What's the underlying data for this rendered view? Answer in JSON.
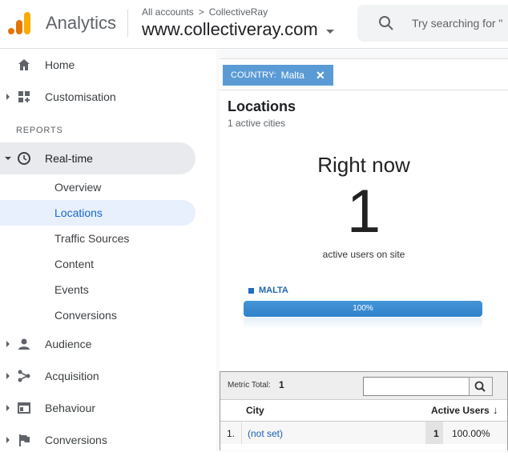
{
  "header": {
    "brand": "Analytics",
    "breadcrumb_root": "All accounts",
    "breadcrumb_sep": ">",
    "breadcrumb_account": "CollectiveRay",
    "property": "www.collectiveray.com",
    "search_placeholder": "Try searching for \"",
    "logo_colors": [
      "#f9ab00",
      "#e37400"
    ]
  },
  "sidebar": {
    "home": "Home",
    "customisation": "Customisation",
    "reports_label": "REPORTS",
    "realtime": "Real-time",
    "realtime_items": [
      "Overview",
      "Locations",
      "Traffic Sources",
      "Content",
      "Events",
      "Conversions"
    ],
    "selected_item": "Locations",
    "audience": "Audience",
    "acquisition": "Acquisition",
    "behaviour": "Behaviour",
    "conversions": "Conversions"
  },
  "filter": {
    "key": "COUNTRY:",
    "value": "Malta",
    "remove": "✕"
  },
  "locations": {
    "title": "Locations",
    "subtitle": "1 active cities",
    "right_now": "Right now",
    "active_count": "1",
    "caption": "active users on site",
    "legend": "MALTA",
    "bar_percent": "100%",
    "bar_fraction": 1.0
  },
  "table": {
    "metric_label": "Metric Total:",
    "metric_value": "1",
    "col_city": "City",
    "col_active": "Active Users",
    "sort_arrow": "↓",
    "rows": [
      {
        "index": "1.",
        "city": "(not set)",
        "active": "1",
        "percent": "100.00%"
      }
    ]
  },
  "colors": {
    "accent_blue": "#1967d2",
    "chip": "#5b9bd5",
    "bar": "#2f82c9"
  }
}
